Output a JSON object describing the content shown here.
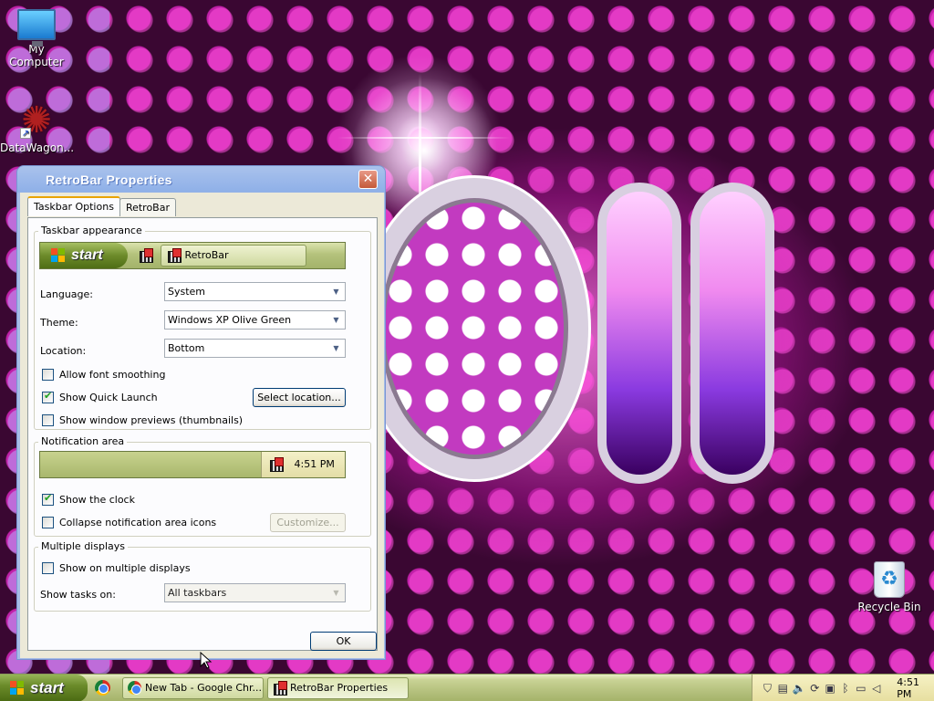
{
  "desktop": {
    "icons": [
      {
        "label": "My Computer",
        "icon": "computer-icon"
      },
      {
        "label": "DataWagon...",
        "icon": "datawagon-icon"
      },
      {
        "label": "Recycle Bin",
        "icon": "recycle-bin-icon"
      }
    ]
  },
  "window": {
    "title": "RetroBar Properties",
    "close_label": "✕",
    "tabs": [
      {
        "label": "Taskbar Options",
        "active": true
      },
      {
        "label": "RetroBar",
        "active": false
      }
    ],
    "appearance": {
      "group_label": "Taskbar appearance",
      "preview_start": "start",
      "preview_task": "RetroBar",
      "language_label": "Language:",
      "language_value": "System",
      "theme_label": "Theme:",
      "theme_value": "Windows XP Olive Green",
      "location_label": "Location:",
      "location_value": "Bottom",
      "font_smoothing_label": "Allow font smoothing",
      "font_smoothing_checked": false,
      "quick_launch_label": "Show Quick Launch",
      "quick_launch_checked": true,
      "select_location_label": "Select location...",
      "previews_label": "Show window previews (thumbnails)",
      "previews_checked": false
    },
    "notification": {
      "group_label": "Notification area",
      "preview_time": "4:51 PM",
      "show_clock_label": "Show the clock",
      "show_clock_checked": true,
      "collapse_label": "Collapse notification area icons",
      "collapse_checked": false,
      "customize_label": "Customize..."
    },
    "displays": {
      "group_label": "Multiple displays",
      "show_multi_label": "Show on multiple displays",
      "show_multi_checked": false,
      "show_tasks_label": "Show tasks on:",
      "show_tasks_value": "All taskbars"
    },
    "ok_label": "OK"
  },
  "taskbar": {
    "start_label": "start",
    "tasks": [
      {
        "label": "New Tab - Google Chr...",
        "icon": "chrome-icon"
      },
      {
        "label": "RetroBar Properties",
        "icon": "retrobar-icon"
      }
    ],
    "clock": "4:51 PM"
  },
  "colors": {
    "xp_title_blue": "#0a58d8",
    "olive_taskbar": "#b6c27f",
    "dialog_face": "#ece9d8"
  }
}
